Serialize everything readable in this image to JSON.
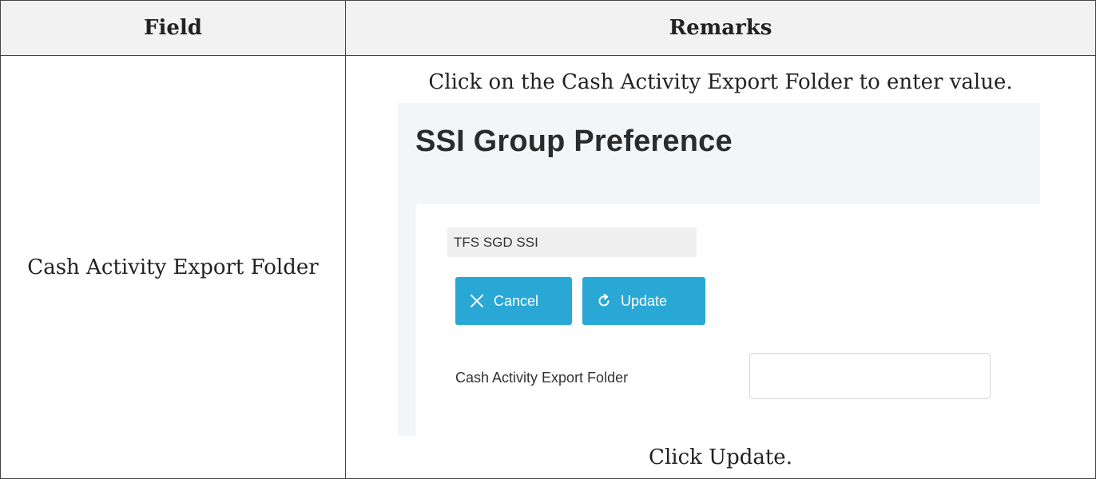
{
  "table": {
    "header_field": "Field",
    "header_remarks": "Remarks",
    "row": {
      "field": "Cash Activity Export Folder",
      "remark_top": "Click on the Cash Activity Export Folder to enter value.",
      "remark_bottom": "Click Update."
    }
  },
  "screenshot": {
    "title": "SSI Group Preference",
    "group_name": "TFS SGD SSI",
    "cancel_label": "Cancel",
    "update_label": "Update",
    "field_label": "Cash Activity Export Folder",
    "field_value": "",
    "icons": {
      "cancel": "close-icon",
      "update": "refresh-icon"
    },
    "colors": {
      "button": "#29a8d6",
      "panel_background": "#f3f6f8"
    }
  }
}
